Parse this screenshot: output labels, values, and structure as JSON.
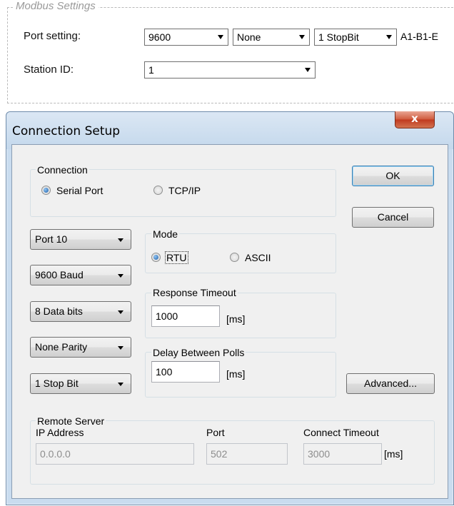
{
  "modbus": {
    "legend": "Modbus Settings",
    "port_label": "Port setting:",
    "baud_value": "9600",
    "parity_value": "None",
    "stopbit_value": "1 StopBit",
    "format_text": "A1-B1-E",
    "station_label": "Station ID:",
    "station_value": "1"
  },
  "dialog": {
    "title": "Connection Setup",
    "close_glyph": "x",
    "ok_label": "OK",
    "cancel_label": "Cancel",
    "advanced_label": "Advanced...",
    "connection": {
      "legend": "Connection",
      "serial_label": "Serial Port",
      "tcp_label": "TCP/IP",
      "selected": "Serial Port"
    },
    "port": "Port 10",
    "baud": "9600 Baud",
    "data_bits": "8 Data bits",
    "parity": "None Parity",
    "stop_bits": "1 Stop Bit",
    "mode": {
      "legend": "Mode",
      "rtu_label": "RTU",
      "ascii_label": "ASCII",
      "selected": "RTU"
    },
    "response_timeout": {
      "legend": "Response Timeout",
      "value": "1000",
      "unit": "[ms]"
    },
    "delay_polls": {
      "legend": "Delay Between Polls",
      "value": "100",
      "unit": "[ms]"
    },
    "remote": {
      "legend": "Remote Server",
      "ip_label": "IP Address",
      "ip_value": "0.0.0.0",
      "port_label": "Port",
      "port_value": "502",
      "timeout_label": "Connect Timeout",
      "timeout_value": "3000",
      "timeout_unit": "[ms]"
    }
  },
  "colors": {
    "window_frame": "#c9dcef",
    "close_button": "#c0391f",
    "radio_checked": "#1f5fa8"
  }
}
